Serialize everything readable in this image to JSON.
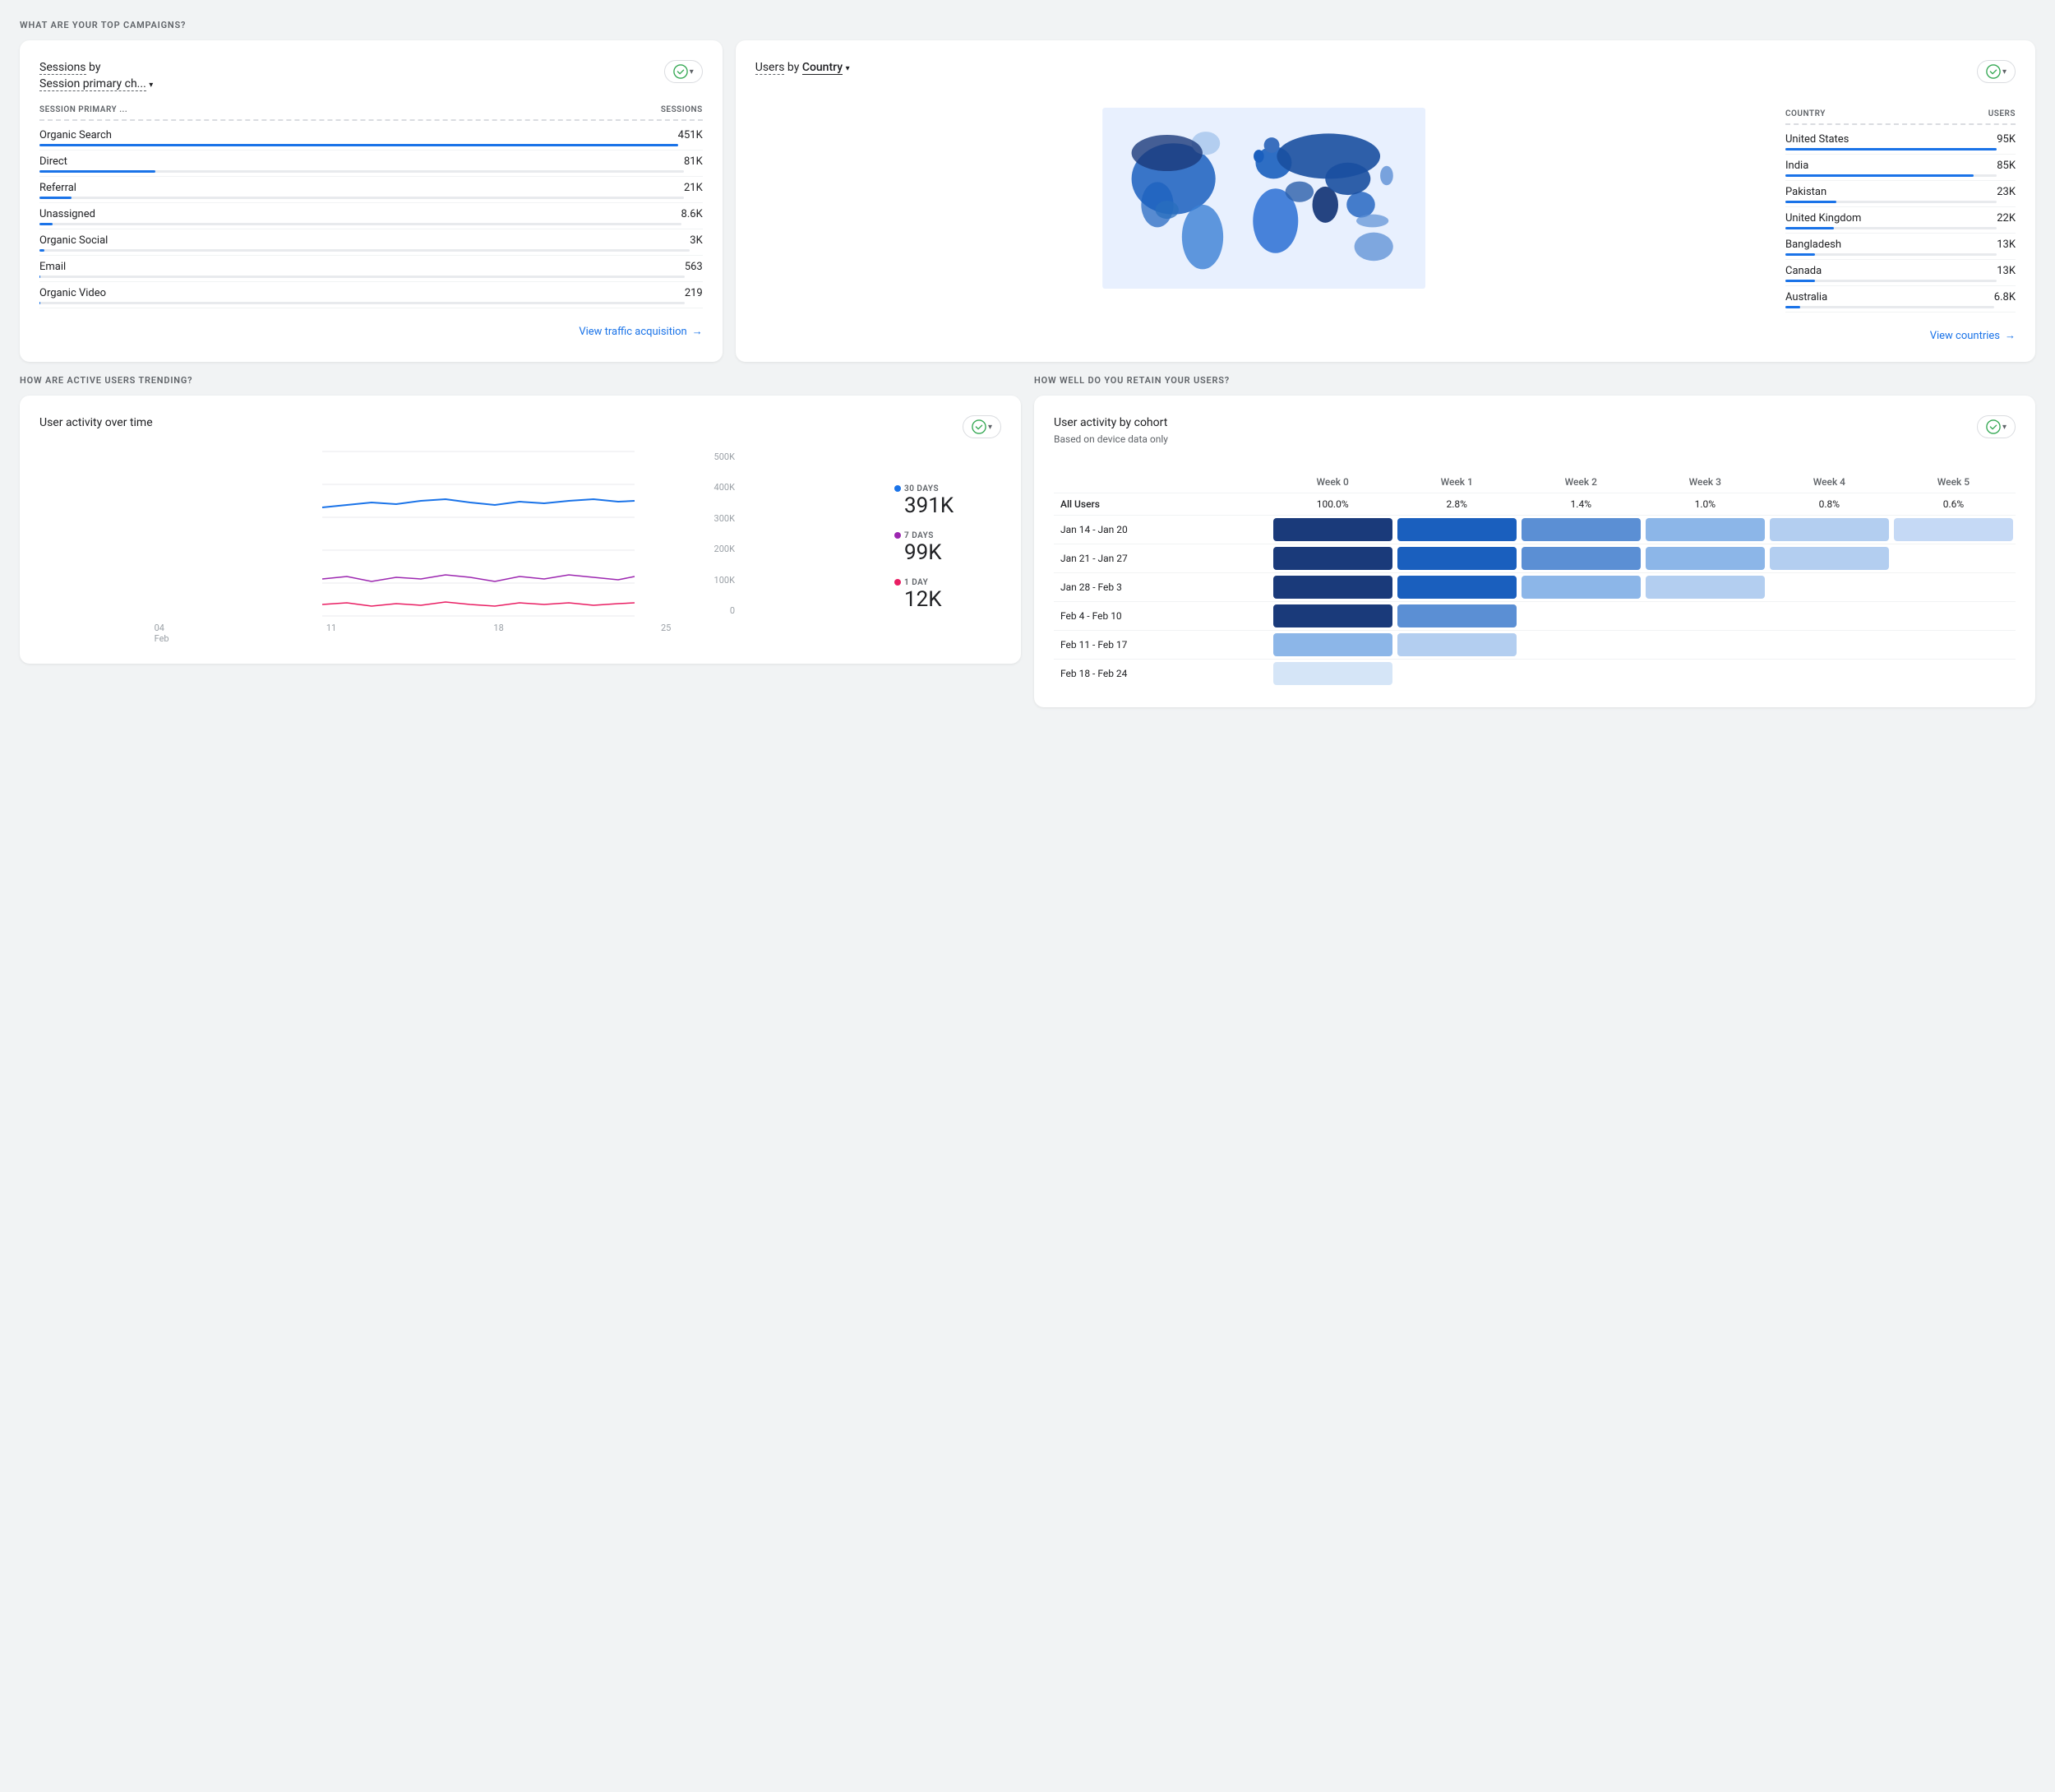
{
  "top_campaigns": {
    "section_title": "WHAT ARE YOUR TOP CAMPAIGNS?",
    "card1": {
      "title_part1": "Sessions",
      "title_by": "by",
      "title_part2": "Session primary ch...",
      "col_session": "SESSION PRIMARY ...",
      "col_sessions": "SESSIONS",
      "rows": [
        {
          "label": "Organic Search",
          "value": "451K",
          "bar_pct": 100
        },
        {
          "label": "Direct",
          "value": "81K",
          "bar_pct": 18
        },
        {
          "label": "Referral",
          "value": "21K",
          "bar_pct": 5
        },
        {
          "label": "Unassigned",
          "value": "8.6K",
          "bar_pct": 2
        },
        {
          "label": "Organic Social",
          "value": "3K",
          "bar_pct": 0.7
        },
        {
          "label": "Email",
          "value": "563",
          "bar_pct": 0.13
        },
        {
          "label": "Organic Video",
          "value": "219",
          "bar_pct": 0.05
        }
      ],
      "view_link": "View traffic acquisition"
    },
    "card2": {
      "title_part1": "Users",
      "title_by": "by",
      "title_part2": "Country",
      "col_country": "COUNTRY",
      "col_users": "USERS",
      "countries": [
        {
          "label": "United States",
          "value": "95K",
          "bar_pct": 100
        },
        {
          "label": "India",
          "value": "85K",
          "bar_pct": 89
        },
        {
          "label": "Pakistan",
          "value": "23K",
          "bar_pct": 24
        },
        {
          "label": "United Kingdom",
          "value": "22K",
          "bar_pct": 23
        },
        {
          "label": "Bangladesh",
          "value": "13K",
          "bar_pct": 14
        },
        {
          "label": "Canada",
          "value": "13K",
          "bar_pct": 14
        },
        {
          "label": "Australia",
          "value": "6.8K",
          "bar_pct": 7
        }
      ],
      "view_link": "View countries"
    }
  },
  "trending": {
    "section_title": "HOW ARE ACTIVE USERS TRENDING?",
    "card_title": "User activity over time",
    "legends": [
      {
        "label": "30 DAYS",
        "value": "391K",
        "color": "#1a73e8"
      },
      {
        "label": "7 DAYS",
        "value": "99K",
        "color": "#9c27b0"
      },
      {
        "label": "1 DAY",
        "value": "12K",
        "color": "#e91e63"
      }
    ],
    "y_labels": [
      "500K",
      "400K",
      "300K",
      "200K",
      "100K",
      "0"
    ],
    "x_labels": [
      "04\nFeb",
      "11",
      "18",
      "25"
    ]
  },
  "cohort": {
    "section_title": "HOW WELL DO YOU RETAIN YOUR USERS?",
    "card_title": "User activity by cohort",
    "subtitle": "Based on device data only",
    "col_headers": [
      "",
      "Week 0",
      "Week 1",
      "Week 2",
      "Week 3",
      "Week 4",
      "Week 5"
    ],
    "rows": [
      {
        "label": "All Users",
        "weeks": [
          "100.0%",
          "2.8%",
          "1.4%",
          "1.0%",
          "0.8%",
          "0.6%"
        ],
        "colors": [
          "",
          "",
          "",
          "",
          "",
          ""
        ]
      },
      {
        "label": "Jan 14 - Jan 20",
        "weeks": [
          "",
          "",
          "",
          "",
          "",
          ""
        ],
        "cell_colors": [
          "#1a3a7a",
          "#1a5fbe",
          "#5b8fd4",
          "#8cb6e8",
          "#b3cef0",
          "#c5d9f5"
        ]
      },
      {
        "label": "Jan 21 - Jan 27",
        "weeks": [
          "",
          "",
          "",
          "",
          "",
          ""
        ],
        "cell_colors": [
          "#1a3a7a",
          "#1a5fbe",
          "#5b8fd4",
          "#8cb6e8",
          "#b3cef0",
          ""
        ]
      },
      {
        "label": "Jan 28 - Feb 3",
        "weeks": [
          "",
          "",
          "",
          "",
          "",
          ""
        ],
        "cell_colors": [
          "#1a3a7a",
          "#1a5fbe",
          "#8cb6e8",
          "#b3cef0",
          "",
          ""
        ]
      },
      {
        "label": "Feb 4 - Feb 10",
        "weeks": [
          "",
          "",
          "",
          "",
          "",
          ""
        ],
        "cell_colors": [
          "#1a3a7a",
          "#5b8fd4",
          "",
          "",
          "",
          ""
        ]
      },
      {
        "label": "Feb 11 - Feb 17",
        "weeks": [
          "",
          "",
          "",
          "",
          "",
          ""
        ],
        "cell_colors": [
          "#8cb6e8",
          "#b3cef0",
          "",
          "",
          "",
          ""
        ]
      },
      {
        "label": "Feb 18 - Feb 24",
        "weeks": [
          "",
          "",
          "",
          "",
          "",
          ""
        ],
        "cell_colors": [
          "#d5e5f7",
          "",
          "",
          "",
          "",
          ""
        ]
      }
    ]
  }
}
